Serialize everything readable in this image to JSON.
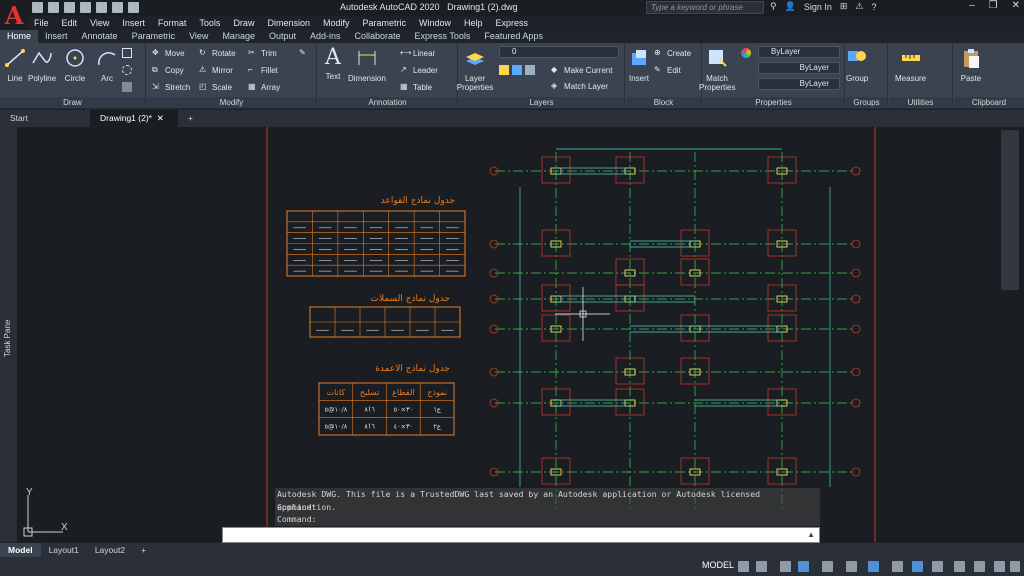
{
  "window": {
    "title": "Autodesk AutoCAD 2020",
    "document": "Drawing1 (2).dwg",
    "search_placeholder": "Type a keyword or phrase",
    "sign_in": "Sign In"
  },
  "menus": [
    "File",
    "Edit",
    "View",
    "Insert",
    "Format",
    "Tools",
    "Draw",
    "Dimension",
    "Modify",
    "Parametric",
    "Window",
    "Help",
    "Express"
  ],
  "ribbon_tabs": [
    "Home",
    "Insert",
    "Annotate",
    "Parametric",
    "View",
    "Manage",
    "Output",
    "Add-ins",
    "Collaborate",
    "Express Tools",
    "Featured Apps"
  ],
  "ribbon": {
    "draw": {
      "title": "Draw",
      "line": "Line",
      "polyline": "Polyline",
      "circle": "Circle",
      "arc": "Arc"
    },
    "modify": {
      "title": "Modify",
      "move": "Move",
      "rotate": "Rotate",
      "trim": "Trim",
      "copy": "Copy",
      "mirror": "Mirror",
      "fillet": "Fillet",
      "stretch": "Stretch",
      "scale": "Scale",
      "array": "Array"
    },
    "annotation": {
      "title": "Annotation",
      "text": "Text",
      "dimension": "Dimension",
      "linear": "Linear",
      "leader": "Leader",
      "table": "Table"
    },
    "layers": {
      "title": "Layers",
      "layer_properties": "Layer Properties",
      "current_layer": "0",
      "make_current": "Make Current",
      "match_layer": "Match Layer"
    },
    "block": {
      "title": "Block",
      "insert": "Insert",
      "create": "Create",
      "edit": "Edit"
    },
    "properties": {
      "title": "Properties",
      "match_properties": "Match Properties",
      "color": "ByLayer",
      "linetype": "ByLayer",
      "lineweight": "ByLayer"
    },
    "groups": {
      "title": "Groups",
      "group": "Group"
    },
    "utilities": {
      "title": "Utilities",
      "measure": "Measure"
    },
    "clipboard": {
      "title": "Clipboard",
      "paste": "Paste"
    }
  },
  "doc_tabs": {
    "start": "Start",
    "drawing": "Drawing1 (2)*",
    "close": "✕",
    "add": "+"
  },
  "task_pane": "Task Pane",
  "drawing": {
    "table1_title": "جدول نماذج القواعد",
    "table2_title": "جدول نماذج السملات",
    "table3_title": "جدول نماذج الاعمدة",
    "table3_headers": [
      "كانات",
      "تسليح",
      "القطاع",
      "نموذج"
    ],
    "table3_rows": [
      [
        "١٠/٨@٥",
        "٨ٚ١٦",
        "٣٠×٥٠",
        "ع١"
      ],
      [
        "١٠/٨@٥",
        "٨ٚ١٦",
        "٣٠×٤٠",
        "ع٢"
      ]
    ],
    "axis_ucs_y": "Y",
    "axis_ucs_x": "X"
  },
  "command": {
    "history": [
      "Autodesk DWG.  This file is a TrustedDWG last saved by an Autodesk application or Autodesk licensed application.",
      "Command:",
      "Command:"
    ],
    "input": ""
  },
  "layout_tabs": [
    "Model",
    "Layout1",
    "Layout2"
  ],
  "statusbar": {
    "mode": "MODEL"
  },
  "colors": {
    "accent": "#e5322d",
    "grid_green": "#39d353",
    "cyan_dim": "#4fd1c5",
    "red_col": "#c0392b",
    "orange_table": "#e67e22"
  }
}
